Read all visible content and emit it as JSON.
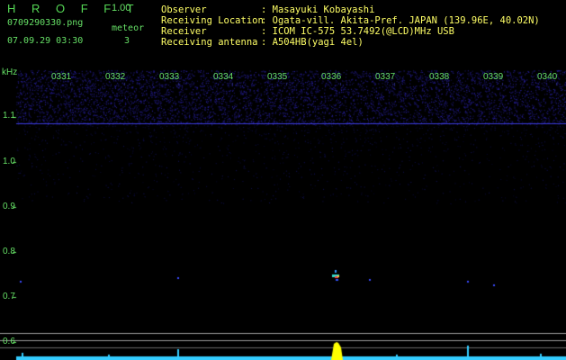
{
  "header": {
    "app_title": "H R O F F T",
    "version": "1.00",
    "filename": "0709290330.png",
    "meteor_label": "meteor",
    "meteor_count": "3",
    "datetime": "07.09.29 03:30"
  },
  "info": [
    {
      "label": "Observer",
      "value": ": Masayuki Kobayashi"
    },
    {
      "label": "Receiving Location",
      "value": ": Ogata-vill. Akita-Pref. JAPAN (139.96E, 40.02N)"
    },
    {
      "label": "Receiver",
      "value": ": ICOM IC-575 53.7492(@LCD)MHz USB"
    },
    {
      "label": "Receiving antenna",
      "value": ": A504HB(yagi 4el)"
    }
  ],
  "axis": {
    "y_unit": "kHz",
    "y_ticks": [
      "1.1",
      "1.0",
      "0.9",
      "0.8",
      "0.7",
      "0.6"
    ],
    "x_ticks": [
      "0331",
      "0332",
      "0333",
      "0334",
      "0335",
      "0336",
      "0337",
      "0338",
      "0339",
      "0340"
    ]
  },
  "colors": {
    "background": "#000000",
    "label_green": "#66e066",
    "value_yellow": "#ffff66",
    "noise_blue": "#1a1a9a",
    "trace_cyan": "#33ccff",
    "meteor_yellow": "#ffff00"
  }
}
